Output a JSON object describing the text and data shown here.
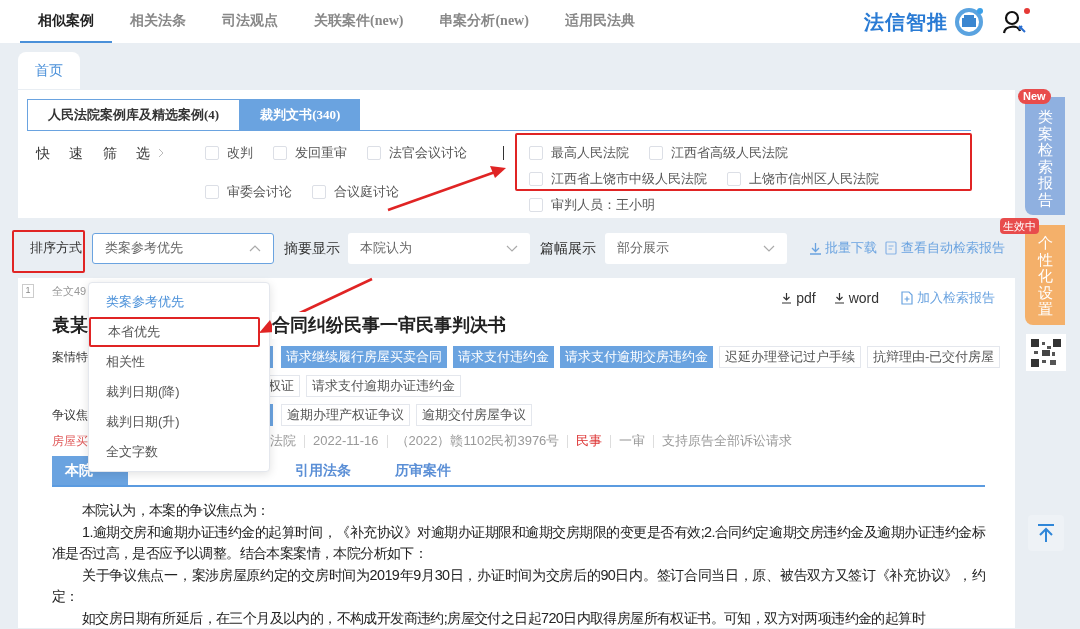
{
  "nav": {
    "tabs": [
      {
        "label": "相似案例",
        "selected": true
      },
      {
        "label": "相关法条",
        "selected": false
      },
      {
        "label": "司法观点",
        "selected": false
      },
      {
        "label": "关联案件(new)",
        "selected": false
      },
      {
        "label": "串案分析(new)",
        "selected": false
      },
      {
        "label": "适用民法典",
        "selected": false
      }
    ],
    "logo": "法信智推",
    "user_notice": true
  },
  "home_tab": "首页",
  "source_tabs": [
    {
      "label": "人民法院案例库及精选案例(4)",
      "selected": false
    },
    {
      "label": "裁判文书(340)",
      "selected": true
    }
  ],
  "quick_filter": "快速筛选",
  "filters": [
    {
      "label": "改判",
      "checked": false
    },
    {
      "label": "发回重审",
      "checked": false
    },
    {
      "label": "法官会议讨论",
      "checked": false
    },
    {
      "label": "审委会讨论",
      "checked": false
    },
    {
      "label": "合议庭讨论",
      "checked": false
    }
  ],
  "courts": [
    {
      "label": "最高人民法院",
      "checked": false
    },
    {
      "label": "江西省高级人民法院",
      "checked": false
    },
    {
      "label": "江西省上饶市中级人民法院",
      "checked": false
    },
    {
      "label": "上饶市信州区人民法院",
      "checked": false
    }
  ],
  "judge": {
    "label": "审判人员：王小明",
    "checked": false
  },
  "sort": {
    "label": "排序方式",
    "value": "类案参考优先",
    "expanded": true,
    "options": [
      {
        "label": "类案参考优先",
        "selected": true,
        "annotated": false
      },
      {
        "label": "本省优先",
        "selected": false,
        "annotated": true
      },
      {
        "label": "相关性",
        "selected": false,
        "annotated": false
      },
      {
        "label": "裁判日期(降)",
        "selected": false,
        "annotated": false
      },
      {
        "label": "裁判日期(升)",
        "selected": false,
        "annotated": false
      },
      {
        "label": "全文字数",
        "selected": false,
        "annotated": false
      }
    ]
  },
  "summary": {
    "label": "摘要显示",
    "value": "本院认为"
  },
  "length": {
    "label": "篇幅展示",
    "value": "部分展示"
  },
  "actions": [
    "批量下载",
    "查看自动检索报告"
  ],
  "result": {
    "index": "1",
    "fulltext": "全文49",
    "downloads": [
      "pdf",
      "word"
    ],
    "add_report": "加入检索报告",
    "title_parts": [
      "袁某",
      "合同纠纷民事一审民事判决书"
    ],
    "tag_rows": [
      {
        "label": "案情特",
        "covered_tag": true,
        "tags": [
          {
            "text": "请求继续履行房屋买卖合同",
            "highlighted": true
          },
          {
            "text": "请求支付违约金",
            "highlighted": true
          },
          {
            "text": "请求支付逾期交房违约金",
            "highlighted": true
          },
          {
            "text": "迟延办理登记过户手续",
            "highlighted": false
          },
          {
            "text": "抗辩理由-已交付房屋",
            "highlighted": false
          }
        ]
      },
      {
        "covered_tag": false,
        "tags": [
          {
            "text": "权证",
            "highlighted": false
          },
          {
            "text": "请求支付逾期办证违约金",
            "highlighted": false
          }
        ]
      },
      {
        "label": "争议焦",
        "covered_tag": true,
        "tags": [
          {
            "text": "逾期办理产权证争议",
            "highlighted": false
          },
          {
            "text": "逾期交付房屋争议",
            "highlighted": false
          }
        ]
      }
    ],
    "meta": {
      "label": "房屋买",
      "items": [
        {
          "text": "法院",
          "highlighted": false
        },
        {
          "text": "2022-11-16",
          "highlighted": false
        },
        {
          "text": "（2022）赣1102民初3976号",
          "highlighted": false
        },
        {
          "text": "民事",
          "highlighted": true
        },
        {
          "text": "一审",
          "highlighted": false
        },
        {
          "text": "支持原告全部诉讼请求",
          "highlighted": false
        }
      ]
    },
    "tabs": [
      {
        "label": "本院",
        "selected": true
      },
      {
        "label": "引用法条",
        "selected": false
      },
      {
        "label": "历审案件",
        "selected": false
      }
    ],
    "paragraphs": [
      "本院认为，本案的争议焦点为：",
      "1.逾期交房和逾期办证违约金的起算时间，《补充协议》对逾期办证期限和逾期交房期限的变更是否有效;2.合同约定逾期交房违约金及逾期办证违约金标准是否过高，是否应予以调整。结合本案案情，本院分析如下：",
      "关于争议焦点一，案涉房屋原约定的交房时间为2019年9月30日，办证时间为交房后的90日内。签订合同当日，原、被告双方又签订《补充协议》，约定：",
      "如交房日期有所延后，在三个月及以内的，不构成开发商违约;房屋交付之日起720日内取得房屋所有权证书。可知，双方对两项违约金的起算时"
    ]
  },
  "side": {
    "report": {
      "badge": "New",
      "label": "类案检索报告"
    },
    "settings": {
      "badge": "生效中",
      "label": "个性化设置"
    }
  }
}
